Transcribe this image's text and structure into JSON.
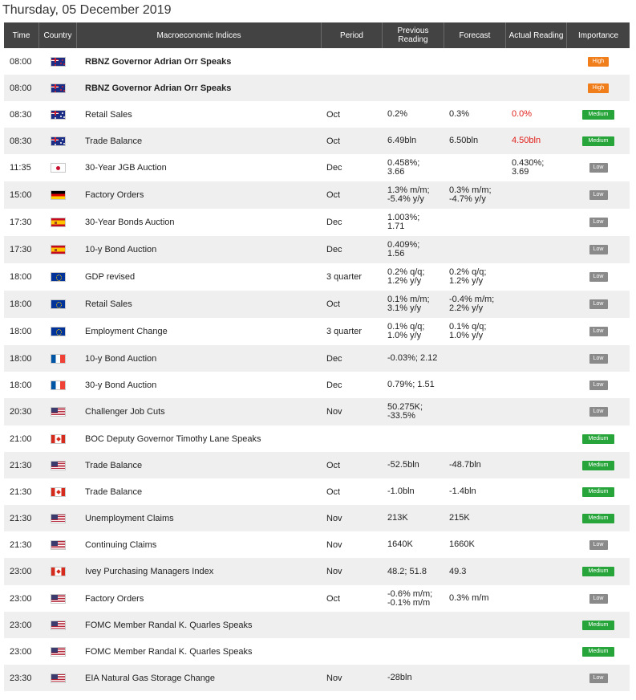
{
  "date": "Thursday, 05 December 2019",
  "headers": {
    "time": "Time",
    "country": "Country",
    "indices": "Macroeconomic Indices",
    "period": "Period",
    "previous": "Previous Reading",
    "forecast": "Forecast",
    "actual": "Actual Reading",
    "importance": "Importance"
  },
  "rows": [
    {
      "time": "08:00",
      "flag": "nz",
      "name": "RBNZ Governor Adrian Orr Speaks",
      "bold": true,
      "period": "",
      "previous": "",
      "forecast": "",
      "actual": "",
      "importance": "High"
    },
    {
      "time": "08:00",
      "flag": "nz",
      "name": "RBNZ Governor Adrian Orr Speaks",
      "bold": true,
      "period": "",
      "previous": "",
      "forecast": "",
      "actual": "",
      "importance": "High"
    },
    {
      "time": "08:30",
      "flag": "au",
      "name": "Retail Sales",
      "bold": false,
      "period": "Oct",
      "previous": "0.2%",
      "forecast": "0.3%",
      "actual": "0.0%",
      "actual_red": true,
      "importance": "Medium"
    },
    {
      "time": "08:30",
      "flag": "au",
      "name": "Trade Balance",
      "bold": false,
      "period": "Oct",
      "previous": "6.49bln",
      "forecast": "6.50bln",
      "actual": "4.50bln",
      "actual_red": true,
      "importance": "Medium"
    },
    {
      "time": "11:35",
      "flag": "jp",
      "name": "30-Year JGB Auction",
      "bold": false,
      "period": "Dec",
      "previous": "0.458%;\n3.66",
      "forecast": "",
      "actual": "0.430%;\n3.69",
      "importance": "Low"
    },
    {
      "time": "15:00",
      "flag": "de",
      "name": "Factory Orders",
      "bold": false,
      "period": "Oct",
      "previous": "1.3% m/m;\n-5.4% y/y",
      "forecast": "0.3% m/m;\n-4.7% y/y",
      "actual": "",
      "importance": "Low"
    },
    {
      "time": "17:30",
      "flag": "es",
      "name": "30-Year Bonds Auction",
      "bold": false,
      "period": "Dec",
      "previous": "1.003%;\n1.71",
      "forecast": "",
      "actual": "",
      "importance": "Low"
    },
    {
      "time": "17:30",
      "flag": "es",
      "name": "10-y Bond Auction",
      "bold": false,
      "period": "Dec",
      "previous": "0.409%;\n1.56",
      "forecast": "",
      "actual": "",
      "importance": "Low"
    },
    {
      "time": "18:00",
      "flag": "eu",
      "name": "GDP revised",
      "bold": false,
      "period": "3 quarter",
      "previous": "0.2% q/q;\n1.2% y/y",
      "forecast": "0.2% q/q;\n1.2% y/y",
      "actual": "",
      "importance": "Low"
    },
    {
      "time": "18:00",
      "flag": "eu",
      "name": "Retail Sales",
      "bold": false,
      "period": "Oct",
      "previous": "0.1% m/m;\n3.1% y/y",
      "forecast": "-0.4% m/m;\n2.2% y/y",
      "actual": "",
      "importance": "Low"
    },
    {
      "time": "18:00",
      "flag": "eu",
      "name": "Employment Change",
      "bold": false,
      "period": "3 quarter",
      "previous": "0.1% q/q;\n1.0% y/y",
      "forecast": "0.1% q/q;\n1.0% y/y",
      "actual": "",
      "importance": "Low"
    },
    {
      "time": "18:00",
      "flag": "fr",
      "name": "10-y Bond Auction",
      "bold": false,
      "period": "Dec",
      "previous": "-0.03%; 2.12",
      "forecast": "",
      "actual": "",
      "importance": "Low"
    },
    {
      "time": "18:00",
      "flag": "fr",
      "name": "30-y Bond Auction",
      "bold": false,
      "period": "Dec",
      "previous": "0.79%; 1.51",
      "forecast": "",
      "actual": "",
      "importance": "Low"
    },
    {
      "time": "20:30",
      "flag": "us",
      "name": "Challenger Job Cuts",
      "bold": false,
      "period": "Nov",
      "previous": "50.275K;\n-33.5%",
      "forecast": "",
      "actual": "",
      "importance": "Low"
    },
    {
      "time": "21:00",
      "flag": "ca",
      "name": "BOC Deputy Governor Timothy Lane Speaks",
      "bold": false,
      "period": "",
      "previous": "",
      "forecast": "",
      "actual": "",
      "importance": "Medium"
    },
    {
      "time": "21:30",
      "flag": "us",
      "name": "Trade Balance",
      "bold": false,
      "period": "Oct",
      "previous": "-52.5bln",
      "forecast": "-48.7bln",
      "actual": "",
      "importance": "Medium"
    },
    {
      "time": "21:30",
      "flag": "ca",
      "name": "Trade Balance",
      "bold": false,
      "period": "Oct",
      "previous": "-1.0bln",
      "forecast": "-1.4bln",
      "actual": "",
      "importance": "Medium"
    },
    {
      "time": "21:30",
      "flag": "us",
      "name": "Unemployment Claims",
      "bold": false,
      "period": "Nov",
      "previous": "213K",
      "forecast": "215K",
      "actual": "",
      "importance": "Medium"
    },
    {
      "time": "21:30",
      "flag": "us",
      "name": "Continuing Claims",
      "bold": false,
      "period": "Nov",
      "previous": "1640K",
      "forecast": "1660K",
      "actual": "",
      "importance": "Low"
    },
    {
      "time": "23:00",
      "flag": "ca",
      "name": "Ivey Purchasing Managers Index",
      "bold": false,
      "period": "Nov",
      "previous": "48.2; 51.8",
      "forecast": "49.3",
      "actual": "",
      "importance": "Medium"
    },
    {
      "time": "23:00",
      "flag": "us",
      "name": "Factory Orders",
      "bold": false,
      "period": "Oct",
      "previous": "-0.6% m/m;\n-0.1% m/m",
      "forecast": "0.3% m/m",
      "actual": "",
      "importance": "Low"
    },
    {
      "time": "23:00",
      "flag": "us",
      "name": "FOMC Member Randal K. Quarles Speaks",
      "bold": false,
      "period": "",
      "previous": "",
      "forecast": "",
      "actual": "",
      "importance": "Medium"
    },
    {
      "time": "23:00",
      "flag": "us",
      "name": "FOMC Member Randal K. Quarles Speaks",
      "bold": false,
      "period": "",
      "previous": "",
      "forecast": "",
      "actual": "",
      "importance": "Medium"
    },
    {
      "time": "23:30",
      "flag": "us",
      "name": "EIA Natural Gas Storage Change",
      "bold": false,
      "period": "Nov",
      "previous": "-28bln",
      "forecast": "",
      "actual": "",
      "importance": "Low"
    }
  ]
}
